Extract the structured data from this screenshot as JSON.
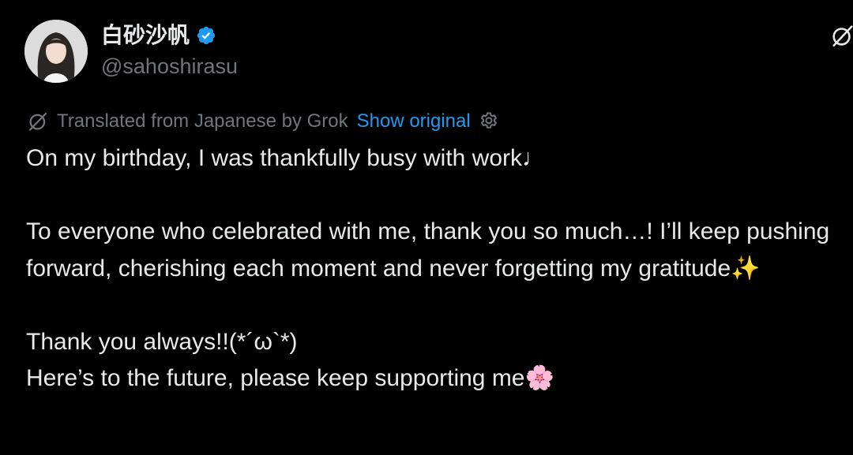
{
  "author": {
    "display_name": "白砂沙帆",
    "handle": "@sahoshirasu",
    "verified": true,
    "avatar": "profile-photo"
  },
  "translation": {
    "label": "Translated from Japanese by Grok",
    "show_original_label": "Show original",
    "icon": "grok-icon",
    "settings_icon": "gear-icon"
  },
  "post": {
    "line1": "On my birthday, I was thankfully busy with work♩",
    "paragraph2": "To everyone who celebrated with me, thank you so much…! I’ll keep pushing forward, cherishing each moment and never forgetting my gratitude✨",
    "line3": "Thank you always!!(*´ω`*)",
    "line4": "Here’s to the future, please keep supporting me🌸"
  },
  "colors": {
    "background": "#000000",
    "text_primary": "#e7e9ea",
    "text_secondary": "#71767b",
    "link": "#1d9bf0",
    "verified": "#1d9bf0"
  }
}
